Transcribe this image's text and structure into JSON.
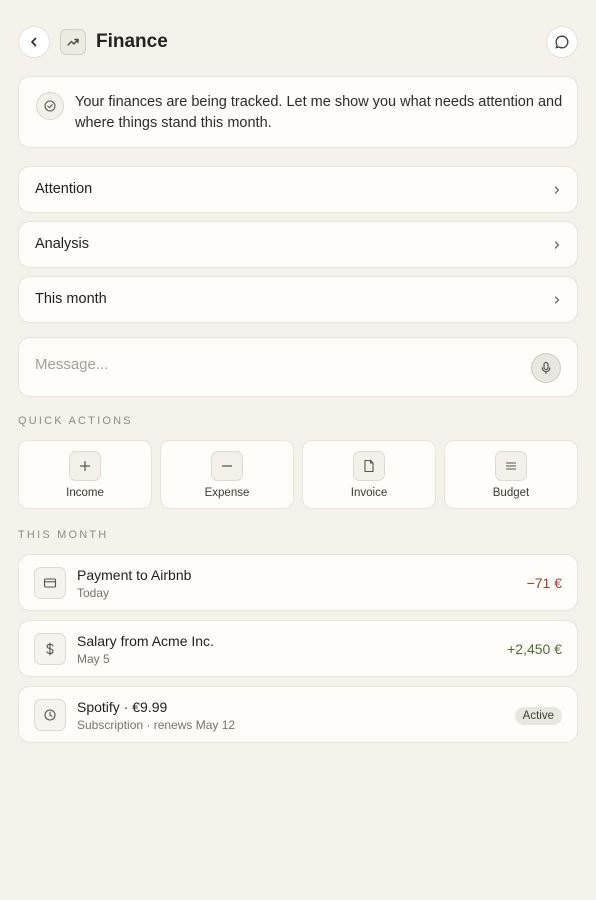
{
  "header": {
    "title": "Finance",
    "back_icon": "chevron-left-icon",
    "app_icon": "trending-up-icon",
    "chat_icon": "message-circle-icon"
  },
  "intro": {
    "icon": "check-circle-icon",
    "text": "Your finances are being tracked. Let me show you what needs attention and where things stand this month."
  },
  "sections": [
    {
      "label": "Attention"
    },
    {
      "label": "Analysis"
    },
    {
      "label": "This month"
    }
  ],
  "message": {
    "placeholder": "Message...",
    "value": "",
    "mic_icon": "microphone-icon"
  },
  "quick_actions": {
    "heading": "QUICK ACTIONS",
    "items": [
      {
        "label": "Income",
        "icon": "plus-icon"
      },
      {
        "label": "Expense",
        "icon": "minus-icon"
      },
      {
        "label": "Invoice",
        "icon": "file-icon"
      },
      {
        "label": "Budget",
        "icon": "list-icon"
      }
    ]
  },
  "this_month": {
    "heading": "THIS MONTH",
    "transactions": [
      {
        "title": "Payment to Airbnb",
        "subtitle": "Today",
        "amount": "−71 €",
        "kind": "negative",
        "icon": "credit-card-icon"
      },
      {
        "title": "Salary from Acme Inc.",
        "subtitle": "May 5",
        "amount": "+2,450 €",
        "kind": "positive",
        "icon": "dollar-icon"
      },
      {
        "title": "Spotify · €9.99",
        "subtitle": "Subscription · renews May 12",
        "status": "Active",
        "icon": "clock-icon"
      }
    ]
  },
  "colors": {
    "background": "#f5f2ec",
    "card": "#fffdfa",
    "negative": "#9b3d2f",
    "positive": "#4f6b35",
    "badge_bg": "#e8e9de"
  }
}
